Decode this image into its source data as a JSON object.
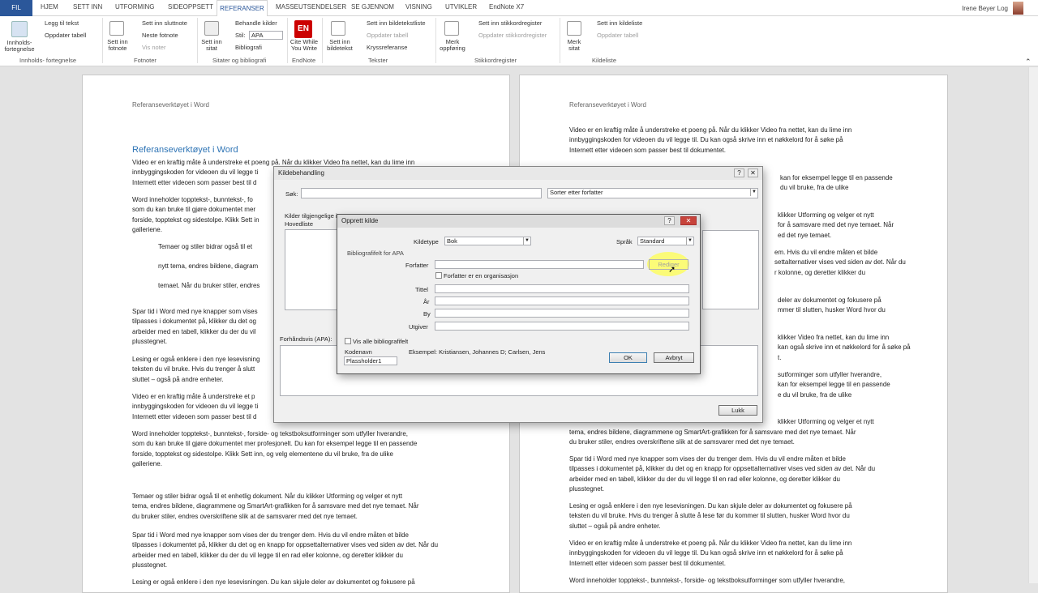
{
  "tabs": {
    "file": "FIL",
    "items": [
      "HJEM",
      "SETT INN",
      "UTFORMING",
      "SIDEOPPSETT",
      "MASSEUTSENDELSER",
      "SE GJENNOM",
      "VISNING",
      "UTVIKLER",
      "EndNote X7"
    ],
    "active": "REFERANSER"
  },
  "user": {
    "name": "Irene Beyer Log"
  },
  "ribbon": {
    "toc_label": "Innholds-\nfortegnelse",
    "toc_items": [
      "Legg til tekst",
      "Oppdater tabell"
    ],
    "toc_group": "Innholds- fortegnelse",
    "footnote_label": "Sett inn\nfotnote",
    "footnote_items": [
      "Sett inn sluttnote",
      "Neste fotnote",
      "Vis noter"
    ],
    "footnote_group": "Fotnoter",
    "citation_label": "Sett inn\nsitat",
    "citation_items": [
      "Behandle kilder",
      "Stil:",
      "Bibliografi"
    ],
    "style_value": "APA",
    "citation_group": "Sitater og bibliografi",
    "endnote_label": "Cite While\nYou Write",
    "endnote_icon_text": "EN",
    "endnote_group": "EndNote",
    "caption_label": "Sett inn\nbildetekst",
    "caption_items": [
      "Sett inn bildetekstliste",
      "Oppdater tabell",
      "Kryssreferanse"
    ],
    "caption_group": "Tekster",
    "index_label": "Merk\noppføring",
    "index_items": [
      "Sett inn stikkordregister",
      "Oppdater stikkordregister"
    ],
    "index_group": "Stikkordregister",
    "toa_label": "Merk\nsitat",
    "toa_items": [
      "Sett inn kildeliste",
      "Oppdater tabell"
    ],
    "toa_group": "Kildeliste"
  },
  "doc_left": {
    "header": "Referanseverktøyet i Word",
    "heading": "Referanseverktøyet i Word",
    "p1": "Video er en kraftig måte å understreke et poeng på. Når du klikker Video fra nettet, kan du lime inn\ninnbyggingskoden for videoen du vil legge ti\nInternett etter videoen som passer best til d",
    "p2": "Word inneholder topptekst-, bunntekst-, fo\nsom du kan bruke til gjøre dokumentet mer\nforside, topptekst og sidestolpe. Klikk Sett in\ngalleriene.",
    "q1": "Temaer og stiler bidrar også til et",
    "q2": "nytt tema, endres bildene, diagram",
    "q3": "temaet. Når du bruker stiler, endres",
    "p3": "Spar tid i Word med nye knapper som vises\ntilpasses i dokumentet på, klikker du det og\narbeider med en tabell, klikker du der du vil\nplusstegnet.",
    "p4": "Lesing er også enklere i den nye lesevisning\nteksten du vil bruke. Hvis du trenger å slutt\nsluttet – også på andre enheter.",
    "p5": "Video er en kraftig måte å understreke et p\ninnbyggingskoden for videoen du vil legge ti\nInternett etter videoen som passer best til d",
    "p6": "Word inneholder topptekst-, bunntekst-, forside- og tekstboksutforminger som utfyller hverandre,\nsom du kan bruke til gjøre dokumentet mer profesjonelt. Du kan for eksempel legge til en passende\nforside, topptekst og sidestolpe. Klikk Sett inn, og velg elementene du vil bruke, fra de ulike\ngalleriene.",
    "p7": "Temaer og stiler bidrar også til et enhetlig dokument. Når du klikker Utforming og velger et nytt\ntema, endres bildene, diagrammene og SmartArt-grafikken for å samsvare med det nye temaet. Når\ndu bruker stiler, endres overskriftene slik at de samsvarer med det nye temaet.",
    "p8": "Spar tid i Word med nye knapper som vises der du trenger dem. Hvis du vil endre måten et bilde\ntilpasses i dokumentet på, klikker du det og en knapp for oppsettalternativer vises ved siden av det. Når du\narbeider med en tabell, klikker du der du vil legge til en rad eller kolonne, og deretter klikker du\nplusstegnet.",
    "p9": "Lesing er også enklere i den nye lesevisningen. Du kan skjule deler av dokumentet og fokusere på"
  },
  "doc_right": {
    "header": "Referanseverktøyet i Word",
    "p1": "Video er en kraftig måte å understreke et poeng på. Når du klikker Video fra nettet, kan du lime inn\ninnbyggingskoden for videoen du vil legge til. Du kan også skrive inn et nøkkelord for å søke på\nInternett etter videoen som passer best til dokumentet.",
    "r1": "kan for eksempel legge til en passende\ndu vil bruke, fra de ulike",
    "r2": "klikker Utforming og velger et nytt\nfor å samsvare med det nye temaet. Når\ned det nye temaet.",
    "r3": "em. Hvis du vil endre måten et bilde\nsettalternativer vises ved siden av det. Når du\nr kolonne, og deretter klikker du",
    "r4": "deler av dokumentet og fokusere på\nmmer til slutten, husker Word hvor du",
    "r5": "klikker Video fra nettet, kan du lime inn\nkan også skrive inn et nøkkelord for å søke på\nt.",
    "r6": "sutforminger som utfyller hverandre,\nkan for eksempel legge til en passende\ne du vil bruke, fra de ulike",
    "r7": "klikker Utforming og velger et nytt",
    "p2": "tema, endres bildene, diagrammene og SmartArt-grafikken for å samsvare med det nye temaet. Når\ndu bruker stiler, endres overskriftene slik at de samsvarer med det nye temaet.",
    "p3": "Spar tid i Word med nye knapper som vises der du trenger dem. Hvis du vil endre måten et bilde\ntilpasses i dokumentet på, klikker du det og en knapp for oppsettalternativer vises ved siden av det. Når du\narbeider med en tabell, klikker du der du vil legge til en rad eller kolonne, og deretter klikker du\nplusstegnet.",
    "p4": "Lesing er også enklere i den nye lesevisningen. Du kan skjule deler av dokumentet og fokusere på\nteksten du vil bruke. Hvis du trenger å slutte å lese før du kommer til slutten, husker Word hvor du\nsluttet – også på andre enheter.",
    "p5": "Video er en kraftig måte å understreke et poeng på. Når du klikker Video fra nettet, kan du lime inn\ninnbyggingskoden for videoen du vil legge til. Du kan også skrive inn et nøkkelord for å søke på\nInternett etter videoen som passer best til dokumentet.",
    "p6": "Word inneholder topptekst-, bunntekst-, forside- og tekstboksutforminger som utfyller hverandre,"
  },
  "source_manager": {
    "title": "Kildebehandling",
    "search_label": "Søk:",
    "sort_value": "Sorter etter forfatter",
    "available_label": "Kilder tilgjengelige i:",
    "master_label": "Hovedliste",
    "preview_label": "Forhåndsvis (APA):",
    "close_button": "Lukk"
  },
  "create_source": {
    "title": "Opprett kilde",
    "type_label": "Kildetype",
    "type_value": "Bok",
    "lang_label": "Språk",
    "lang_value": "Standard",
    "fields_heading": "Bibliografifelt for APA",
    "author_label": "Forfatter",
    "edit_button": "Rediger",
    "org_checkbox": "Forfatter er en organisasjon",
    "title_label": "Tittel",
    "year_label": "År",
    "city_label": "By",
    "publisher_label": "Utgiver",
    "show_all": "Vis alle bibliografifelt",
    "tag_label": "Kodenavn",
    "tag_value": "Plassholder1",
    "example": "Eksempel: Kristiansen, Johannes D; Carlsen, Jens",
    "ok_button": "OK",
    "cancel_button": "Avbryt"
  },
  "colors": {
    "accent": "#2b579a",
    "heading": "#2e74b5",
    "highlight": "#ffff66"
  }
}
